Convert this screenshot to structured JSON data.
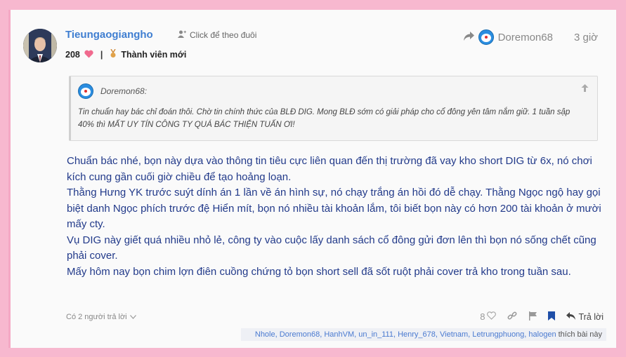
{
  "post": {
    "username": "Tieungaogiangho",
    "follow_label": "Click để theo đuôi",
    "likes_count": "208",
    "member_title": "Thành viên mới",
    "reply_to_user": "Doremon68",
    "time": "3 giờ",
    "quote": {
      "author": "Doremon68:",
      "text": "Tin chuẩn hay bác chỉ đoán thôi. Chờ tin chính thức của BLĐ DIG. Mong BLĐ sớm có giải pháp cho cổ đông yên tâm nắm giữ. 1 tuần sập 40% thì MẤT UY TÍN CÔNG TY QUÁ BÁC THIỆN TUẤN ƠI!"
    },
    "body": [
      "Chuẩn bác nhé, bọn này dựa vào thông tin tiêu cực liên quan đến thị trường đã vay kho short DIG từ 6x, nó chơi kích cung gần cuối giờ chiều để tạo hoảng loạn.",
      "Thằng Hưng YK trước suýt dính án 1 lần về án hình sự, nó chạy trắng án hồi đó dễ chạy. Thằng Ngọc ngộ hay gọi biệt danh Ngọc phích trước đệ Hiển mít, bọn nó nhiều tài khoản lắm, tôi biết bọn này có hơn 200 tài khoản ở mười mấy cty.",
      "Vụ DIG này giết quá nhiều nhỏ lẻ, công ty vào cuộc lấy danh sách cổ đông gửi đơn lên thì bọn nó sống chết cũng phải cover.",
      "Mấy hôm nay bọn chim lợn điên cuồng chứng tỏ bọn short sell đã sốt ruột phải cover trả kho trong tuần sau."
    ],
    "replies_label": "Có 2 người trả lời",
    "like_count": "8",
    "reply_button": "Trả lời",
    "liked_by": "Nhole, Doremon68, HanhVM, un_in_111, Henry_678, Vietnam, Letrungphuong, halogen",
    "liked_suffix": "thích bài này"
  },
  "colors": {
    "border_pink": "#f7b8cf",
    "username_blue": "#3f7ed1",
    "body_text": "#223a8a",
    "heart": "#f06a8e"
  },
  "icons": [
    "user-plus-icon",
    "heart-icon",
    "medal-icon",
    "share-icon",
    "arrow-up-icon",
    "chevron-down-icon",
    "heart-outline-icon",
    "link-icon",
    "flag-icon",
    "bookmark-icon",
    "reply-icon"
  ]
}
